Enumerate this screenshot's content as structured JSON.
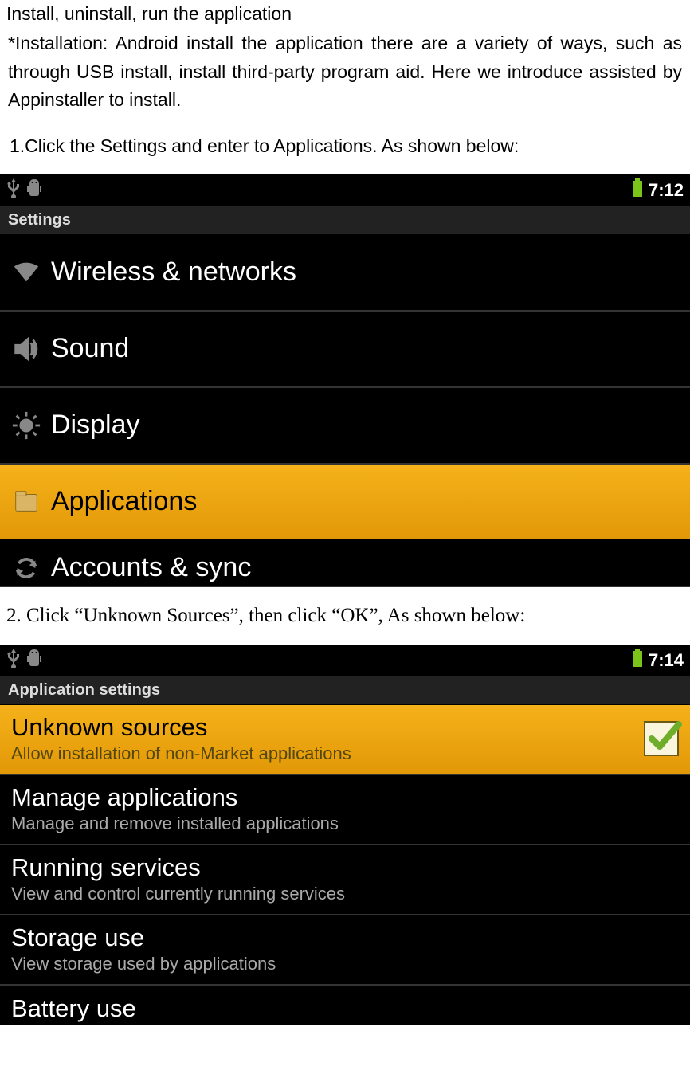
{
  "doc": {
    "heading": "Install, uninstall, run the application",
    "intro": "*Installation: Android install the application there are a variety of ways, such as through USB install, install third-party program aid. Here we introduce assisted by Appinstaller to install.",
    "step1": "1.Click the Settings and enter to Applications. As shown below:",
    "step2": "2. Click “Unknown Sources”, then click “OK”, As shown below:"
  },
  "shot1": {
    "time": "7:12",
    "title": "Settings",
    "items": [
      {
        "label": "Wireless & networks",
        "icon": "wifi"
      },
      {
        "label": "Sound",
        "icon": "sound"
      },
      {
        "label": "Display",
        "icon": "display"
      },
      {
        "label": "Applications",
        "icon": "apps",
        "highlight": true
      },
      {
        "label": "Accounts & sync",
        "icon": "sync",
        "cut": true
      }
    ]
  },
  "shot2": {
    "time": "7:14",
    "title": "Application settings",
    "items": [
      {
        "title": "Unknown sources",
        "sub": "Allow installation of non-Market applications",
        "checked": true,
        "highlight": true
      },
      {
        "title": "Manage applications",
        "sub": "Manage and remove installed applications"
      },
      {
        "title": "Running services",
        "sub": "View and control currently running services"
      },
      {
        "title": "Storage use",
        "sub": "View storage used by applications"
      },
      {
        "title": "Battery use",
        "cut": true
      }
    ]
  }
}
